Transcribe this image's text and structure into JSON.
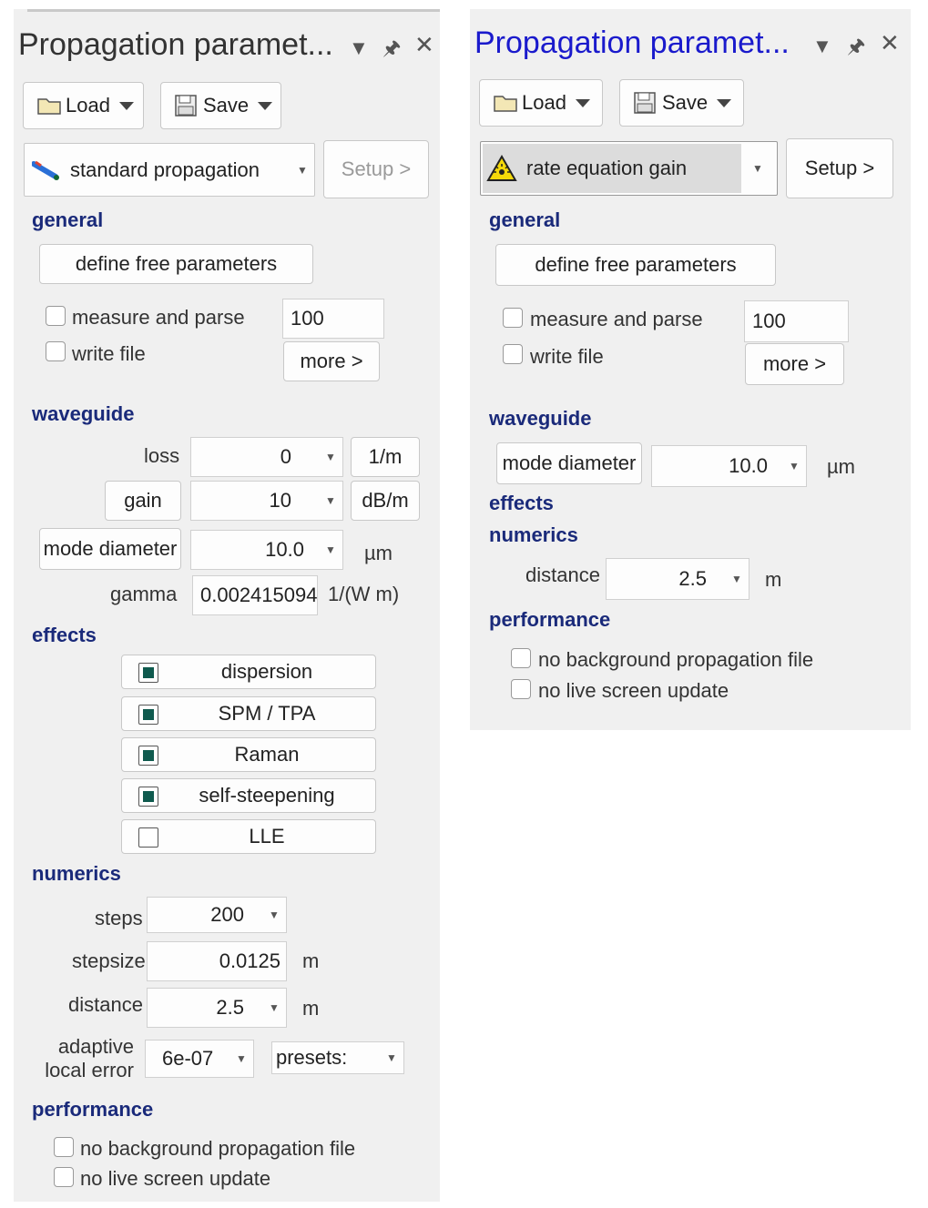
{
  "left": {
    "title": "Propagation paramet...",
    "load_label": "Load",
    "save_label": "Save",
    "propagation_type": "standard propagation",
    "setup_label": "Setup >",
    "general": {
      "heading": "general",
      "define_free": "define free parameters",
      "measure_parse": "measure and parse",
      "measure_value": "100",
      "write_file": "write file",
      "more": "more >"
    },
    "waveguide": {
      "heading": "waveguide",
      "loss_label": "loss",
      "loss_value": "0",
      "loss_unit": "1/m",
      "gain_label": "gain",
      "gain_value": "10",
      "gain_unit": "dB/m",
      "mode_label": "mode diameter",
      "mode_value": "10.0",
      "mode_unit": "µm",
      "gamma_label": "gamma",
      "gamma_value": "0.002415094339",
      "gamma_unit": "1/(W m)"
    },
    "effects": {
      "heading": "effects",
      "items": [
        {
          "label": "dispersion",
          "checked": true
        },
        {
          "label": "SPM / TPA",
          "checked": true
        },
        {
          "label": "Raman",
          "checked": true
        },
        {
          "label": "self-steepening",
          "checked": true
        },
        {
          "label": "LLE",
          "checked": false
        }
      ]
    },
    "numerics": {
      "heading": "numerics",
      "steps_label": "steps",
      "steps_value": "200",
      "stepsize_label": "stepsize",
      "stepsize_value": "0.0125",
      "stepsize_unit": "m",
      "distance_label": "distance",
      "distance_value": "2.5",
      "distance_unit": "m",
      "adaptive_label_1": "adaptive",
      "adaptive_label_2": "local error",
      "adaptive_value": "6e-07",
      "presets": "presets:"
    },
    "performance": {
      "heading": "performance",
      "no_background": "no background propagation file",
      "no_live": "no live screen update"
    }
  },
  "right": {
    "title": "Propagation paramet...",
    "load_label": "Load",
    "save_label": "Save",
    "propagation_type": "rate equation gain",
    "setup_label": "Setup >",
    "general": {
      "heading": "general",
      "define_free": "define free parameters",
      "measure_parse": "measure and parse",
      "measure_value": "100",
      "write_file": "write file",
      "more": "more >"
    },
    "waveguide": {
      "heading": "waveguide",
      "mode_label": "mode diameter",
      "mode_value": "10.0",
      "mode_unit": "µm"
    },
    "effects": {
      "heading": "effects"
    },
    "numerics": {
      "heading": "numerics",
      "distance_label": "distance",
      "distance_value": "2.5",
      "distance_unit": "m"
    },
    "performance": {
      "heading": "performance",
      "no_background": "no background propagation file",
      "no_live": "no live screen update"
    }
  },
  "icons": {
    "dropdown": "chevron-down-icon",
    "pin": "pin-icon",
    "close": "close-icon",
    "folder": "folder-icon",
    "floppy": "floppy-disk-icon",
    "laser": "laser-warning-icon",
    "fiber": "fiber-icon"
  },
  "colors": {
    "active_title": "#1a1acc",
    "section_heading": "#1a2a7a",
    "checkbox_fill": "#0f5a4e",
    "warning_yellow": "#f5d90a"
  }
}
